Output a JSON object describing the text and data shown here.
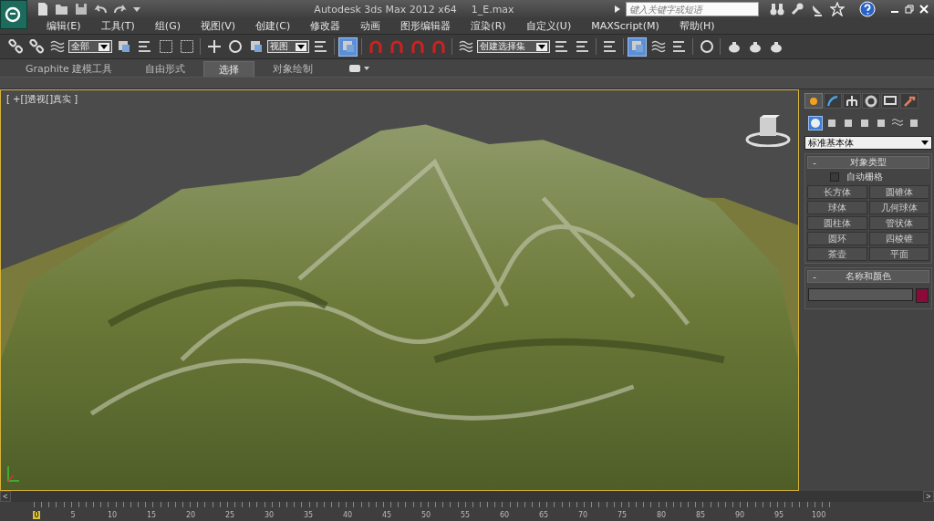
{
  "title_bar": {
    "app_title": "Autodesk 3ds Max  2012 x64",
    "file_name": "1_E.max",
    "search": {
      "placeholder": "键入关键字或短语"
    }
  },
  "menu": [
    "编辑(E)",
    "工具(T)",
    "组(G)",
    "视图(V)",
    "创建(C)",
    "修改器",
    "动画",
    "图形编辑器",
    "渲染(R)",
    "自定义(U)",
    "MAXScript(M)",
    "帮助(H)"
  ],
  "main_toolbar": {
    "selection_filter": "全部",
    "reference_coordinate": "视图",
    "named_selection_set": "创建选择集",
    "tools": [
      {
        "selected": false
      },
      {
        "selected": false
      },
      {
        "selected": false
      },
      {
        "selected": false
      },
      {
        "selected": false
      },
      {
        "selected": false
      },
      {
        "selected": false
      },
      {
        "selected": false
      },
      {
        "selected": false
      },
      {
        "selected": false
      },
      {
        "selected": false
      },
      {
        "selected": true
      },
      {
        "selected": false
      },
      {
        "selected": false
      },
      {
        "selected": false
      },
      {
        "selected": false
      },
      {
        "selected": false
      },
      {
        "selected": false
      },
      {
        "selected": false
      },
      {
        "selected": false
      },
      {
        "selected": true
      },
      {
        "selected": false
      },
      {
        "selected": false
      },
      {
        "selected": false
      },
      {
        "selected": false
      },
      {
        "selected": false
      },
      {
        "selected": false
      }
    ]
  },
  "ribbon_tabs": [
    {
      "label": "Graphite 建模工具",
      "selected": false
    },
    {
      "label": "自由形式",
      "selected": false
    },
    {
      "label": "选择",
      "selected": true
    },
    {
      "label": "对象绘制",
      "selected": false
    }
  ],
  "viewport": {
    "label": "[ +[]透视[]真实 ]"
  },
  "command_panel": {
    "tabs": [
      {
        "selected": true
      },
      {
        "selected": false
      },
      {
        "selected": false
      },
      {
        "selected": false
      },
      {
        "selected": false
      },
      {
        "selected": false
      }
    ],
    "categories": [
      {
        "selected": true
      },
      {
        "selected": false
      },
      {
        "selected": false
      },
      {
        "selected": false
      },
      {
        "selected": false
      },
      {
        "selected": false
      },
      {
        "selected": false
      }
    ],
    "object_category": "标准基本体",
    "object_type": {
      "collapse_symbol": "-",
      "title": "对象类型",
      "autogrid": {
        "label": "自动栅格",
        "checked": false
      },
      "buttons": [
        "长方体",
        "圆锥体",
        "球体",
        "几何球体",
        "圆柱体",
        "管状体",
        "圆环",
        "四棱锥",
        "茶壶",
        "平面"
      ]
    },
    "name_and_color": {
      "collapse_symbol": "-",
      "title": "名称和颜色",
      "color": "#8b0a3a"
    }
  },
  "timeline": {
    "prev": "<",
    "next": ">",
    "ticks": [
      {
        "label": "0",
        "selected": true
      },
      {
        "label": "5",
        "selected": false
      },
      {
        "label": "10",
        "selected": false
      },
      {
        "label": "15",
        "selected": false
      },
      {
        "label": "20",
        "selected": false
      },
      {
        "label": "25",
        "selected": false
      },
      {
        "label": "30",
        "selected": false
      },
      {
        "label": "35",
        "selected": false
      },
      {
        "label": "40",
        "selected": false
      },
      {
        "label": "45",
        "selected": false
      },
      {
        "label": "50",
        "selected": false
      },
      {
        "label": "55",
        "selected": false
      },
      {
        "label": "60",
        "selected": false
      },
      {
        "label": "65",
        "selected": false
      },
      {
        "label": "70",
        "selected": false
      },
      {
        "label": "75",
        "selected": false
      },
      {
        "label": "80",
        "selected": false
      },
      {
        "label": "85",
        "selected": false
      },
      {
        "label": "90",
        "selected": false
      },
      {
        "label": "95",
        "selected": false
      },
      {
        "label": "100",
        "selected": false
      }
    ]
  }
}
